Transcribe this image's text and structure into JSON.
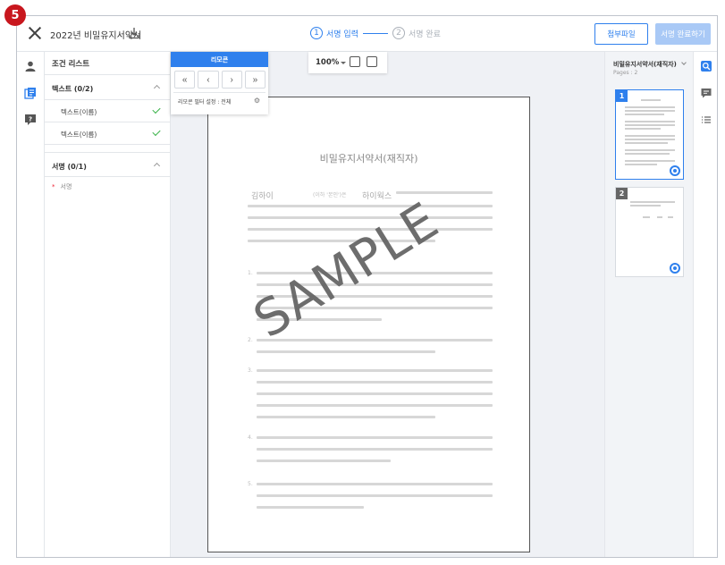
{
  "step_badge": "5",
  "header": {
    "doc_title": "2022년 비밀유지서약서",
    "step1_num": "1",
    "step1_label": "서명 입력",
    "step2_num": "2",
    "step2_label": "서명 완료",
    "attach_button": "첨부파일",
    "finish_button": "서명 완료하기"
  },
  "conditions": {
    "title": "조건 리스트",
    "text_section": "텍스트 (0/2)",
    "text_items": [
      "텍스트(이름)",
      "텍스트(이름)"
    ],
    "sign_section": "서명 (0/1)",
    "required_mark": "*",
    "sign_item": "서명"
  },
  "remote": {
    "title": "리모콘",
    "first": "«",
    "prev": "‹",
    "next": "›",
    "last": "»",
    "filter_label": "리모콘 필터 설정 : 전체"
  },
  "viewer": {
    "zoom": "100%",
    "page_title": "비밀유지서약서(재직자)",
    "field_name": "김하이",
    "field_name_hint": "(이하 '본인')은",
    "field_company": "하이웍스",
    "paragraph_numbers": [
      "1.",
      "2.",
      "3.",
      "4.",
      "5."
    ],
    "watermark": "SAMPLE"
  },
  "thumbs": {
    "title": "비밀유지서약서(재직자)",
    "pages_label": "Pages : 2",
    "page_numbers": [
      "1",
      "2"
    ]
  },
  "colors": {
    "accent": "#2f80ed",
    "badge": "#c8171e",
    "check": "#3bb34a",
    "finish_disabled": "#a9c9f6"
  }
}
